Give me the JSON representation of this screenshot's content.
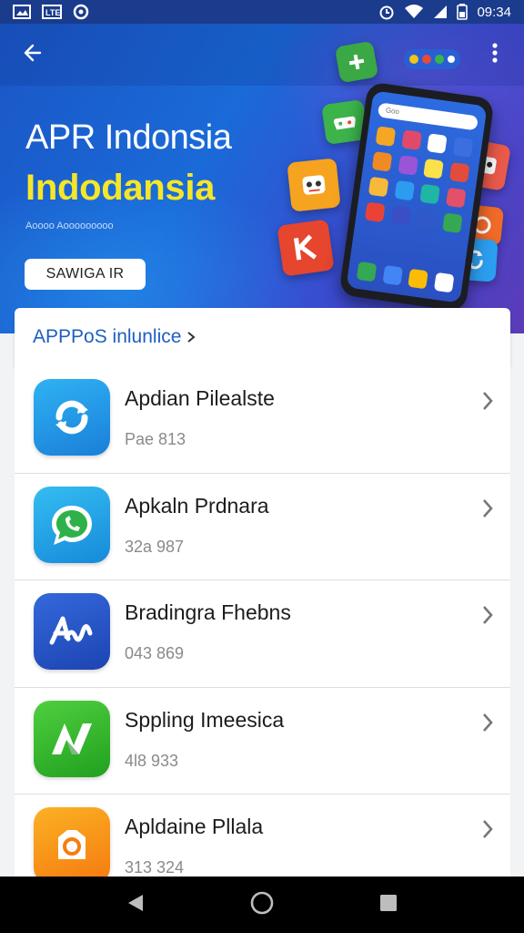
{
  "status_bar": {
    "time": "09:34",
    "left_icons": [
      "gallery-icon",
      "sim-icon",
      "circle-notification-icon"
    ],
    "right_icons": [
      "alarm-icon",
      "wifi-icon",
      "signal-icon",
      "battery-icon"
    ]
  },
  "hero": {
    "title": "APR Indonsia",
    "subtitle": "Indodansia",
    "caption": "Aoooo Aooooooooo",
    "button_label": "SAWIGA IR",
    "phone_search_placeholder": "Goo",
    "colors": {
      "title": "#ffffff",
      "subtitle": "#f5e62a",
      "background": "#1a6ad8"
    }
  },
  "section": {
    "title": "APPPoS inlunlice"
  },
  "apps": [
    {
      "name": "Apdian Pilealste",
      "meta": "Pae 813",
      "icon": "sync-icon",
      "icon_colors": [
        "#27a6f0",
        "#1a7cd6"
      ]
    },
    {
      "name": "Apkaln Prdnara",
      "meta": "32a 987",
      "icon": "chat-bubble-icon",
      "icon_colors": [
        "#2ab2ef",
        "#1589d9"
      ]
    },
    {
      "name": "Bradingra Fhebns",
      "meta": "043 869",
      "icon": "signature-icon",
      "icon_colors": [
        "#2e62d8",
        "#1c42b0"
      ]
    },
    {
      "name": "Sppling Imeesica",
      "meta": "4l8 933",
      "icon": "n-logo-icon",
      "icon_colors": [
        "#45c53a",
        "#23a021"
      ]
    },
    {
      "name": "Apldaine Pllala",
      "meta": "313 324",
      "icon": "camera-tag-icon",
      "icon_colors": [
        "#fba21c",
        "#f57e10"
      ]
    }
  ],
  "nav": {
    "buttons": [
      "back-triangle-icon",
      "home-circle-icon",
      "recents-square-icon"
    ]
  }
}
